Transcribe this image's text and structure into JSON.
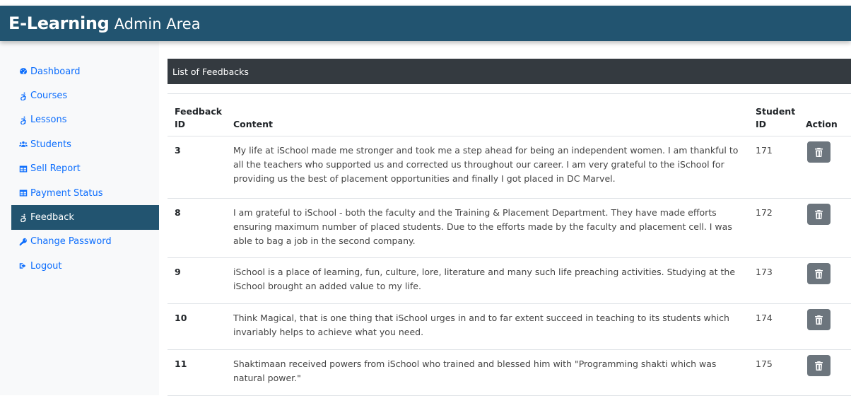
{
  "header": {
    "brand_bold": "E-Learning",
    "brand_rest": "Admin Area",
    "bg_color": "#225470"
  },
  "sidebar": {
    "items": [
      {
        "label": "Dashboard",
        "icon": "tachometer-icon",
        "active": false
      },
      {
        "label": "Courses",
        "icon": "accessible-icon",
        "active": false
      },
      {
        "label": "Lessons",
        "icon": "accessible-icon",
        "active": false
      },
      {
        "label": "Students",
        "icon": "users-icon",
        "active": false
      },
      {
        "label": "Sell Report",
        "icon": "table-icon",
        "active": false
      },
      {
        "label": "Payment Status",
        "icon": "table-icon",
        "active": false
      },
      {
        "label": "Feedback",
        "icon": "accessible-icon",
        "active": true
      },
      {
        "label": "Change Password",
        "icon": "key-icon",
        "active": false
      },
      {
        "label": "Logout",
        "icon": "sign-out-icon",
        "active": false
      }
    ]
  },
  "main": {
    "panel_title": "List of Feedbacks",
    "columns": {
      "id_line1": "Feedback",
      "id_line2": "ID",
      "content": "Content",
      "sid_line1": "Student",
      "sid_line2": "ID",
      "action": "Action"
    },
    "rows": [
      {
        "id": "3",
        "content": "My life at iSchool made me stronger and took me a step ahead for being an independent women. I am thankful to all the teachers who supported us and corrected us throughout our career. I am very grateful to the iSchool for providing us the best of placement opportunities and finally I got placed in DC Marvel.",
        "student_id": "171",
        "action_icon": "trash-icon"
      },
      {
        "id": "8",
        "content": "I am grateful to iSchool - both the faculty and the Training & Placement Department. They have made efforts ensuring maximum number of placed students. Due to the efforts made by the faculty and placement cell. I was able to bag a job in the second company.",
        "student_id": "172",
        "action_icon": "trash-icon"
      },
      {
        "id": "9",
        "content": "iSchool is a place of learning, fun, culture, lore, literature and many such life preaching activities. Studying at the iSchool brought an added value to my life.",
        "student_id": "173",
        "action_icon": "trash-icon"
      },
      {
        "id": "10",
        "content": "Think Magical, that is one thing that iSchool urges in and to far extent succeed in teaching to its students which invariably helps to achieve what you need.",
        "student_id": "174",
        "action_icon": "trash-icon"
      },
      {
        "id": "11",
        "content": "Shaktimaan received powers from iSchool who trained and blessed him with \"Programming shakti which was natural power.\"",
        "student_id": "175",
        "action_icon": "trash-icon"
      }
    ]
  }
}
